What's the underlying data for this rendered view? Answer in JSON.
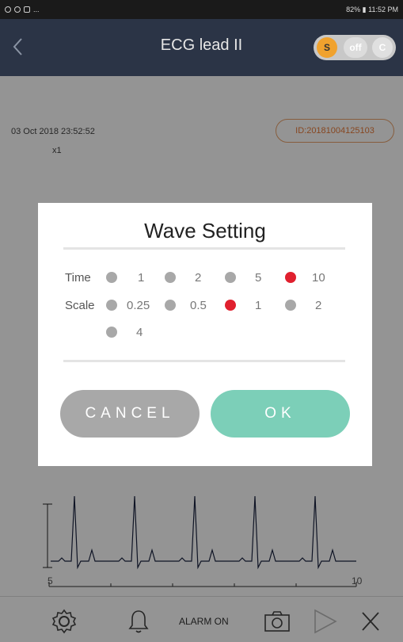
{
  "status_bar": {
    "left_notifications": "...",
    "right_text": "82% ▮ 11:52 PM"
  },
  "header": {
    "title": "ECG lead II",
    "toggle": {
      "s": "S",
      "off": "off",
      "c": "C"
    }
  },
  "monitor": {
    "timestamp": "03 Oct 2018 23:52:52",
    "multiplier": "x1",
    "patient_id": "ID:20181004125103",
    "scale_start": "5",
    "scale_end": "10"
  },
  "dialog": {
    "title": "Wave Setting",
    "time": {
      "label": "Time",
      "options": [
        "1",
        "2",
        "5",
        "10"
      ],
      "selected": "10"
    },
    "scale": {
      "label": "Scale",
      "options": [
        "0.25",
        "0.5",
        "1",
        "2",
        "4"
      ],
      "selected": "1"
    },
    "cancel_label": "CANCEL",
    "ok_label": "OK"
  },
  "bottom_bar": {
    "alarm_label": "ALARM ON"
  },
  "colors": {
    "header_bg": "#2b3446",
    "selected_radio": "#e0202e",
    "ok_button": "#7ccfb8",
    "cancel_button": "#a8a8a8",
    "toggle_s": "#f0a22e",
    "id_accent": "#e87b3a"
  }
}
